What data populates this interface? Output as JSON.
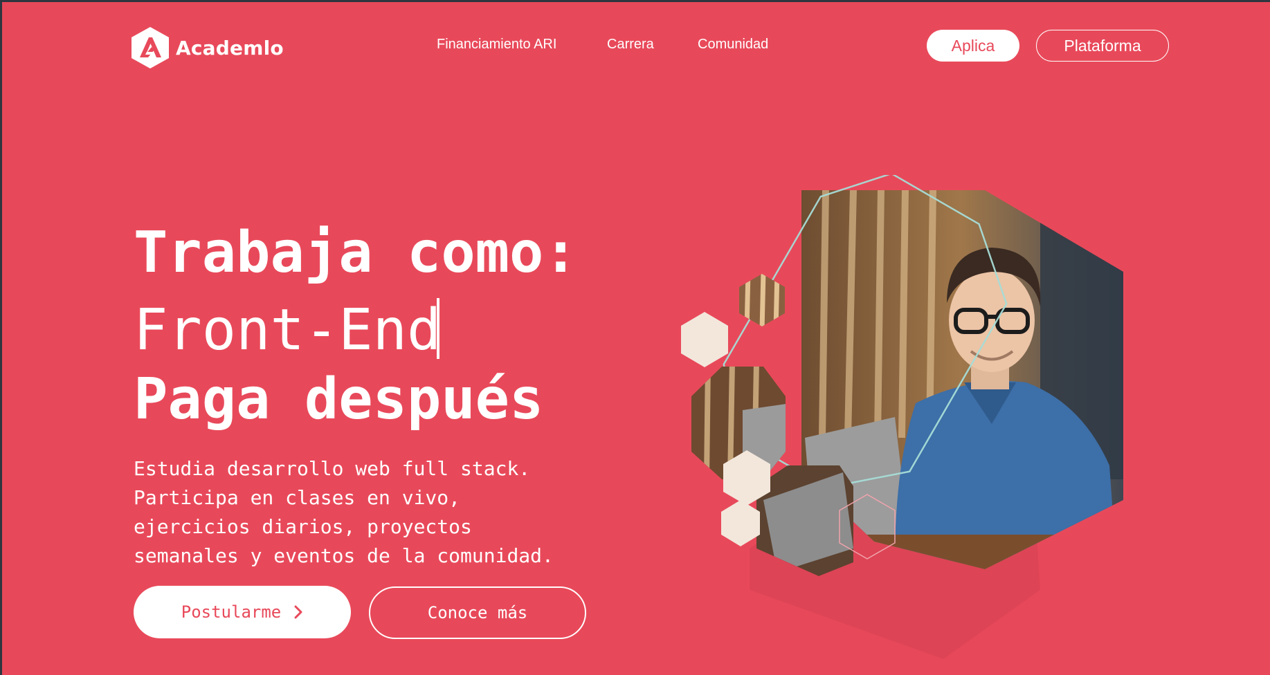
{
  "header": {
    "brand": "Academlo",
    "nav": [
      "Financiamiento ARI",
      "Carrera",
      "Comunidad"
    ],
    "apply_label": "Aplica",
    "platform_label": "Plataforma"
  },
  "hero": {
    "line1": "Trabaja como:",
    "line2": "Front-End",
    "line3": "Paga después",
    "description": [
      "Estudia desarrollo web full stack.",
      "Participa en clases en vivo,",
      "ejercicios diarios, proyectos",
      "semanales y eventos de la comunidad."
    ],
    "primary_cta": "Postularme",
    "secondary_cta": "Conoce más"
  },
  "colors": {
    "brand": "#e8495a",
    "text": "#ffffff",
    "hex_light": "#f3e7dc",
    "outline_hex": "#9ad9d3"
  },
  "icons": [
    "academlo-logo-icon",
    "chevron-right-icon"
  ]
}
